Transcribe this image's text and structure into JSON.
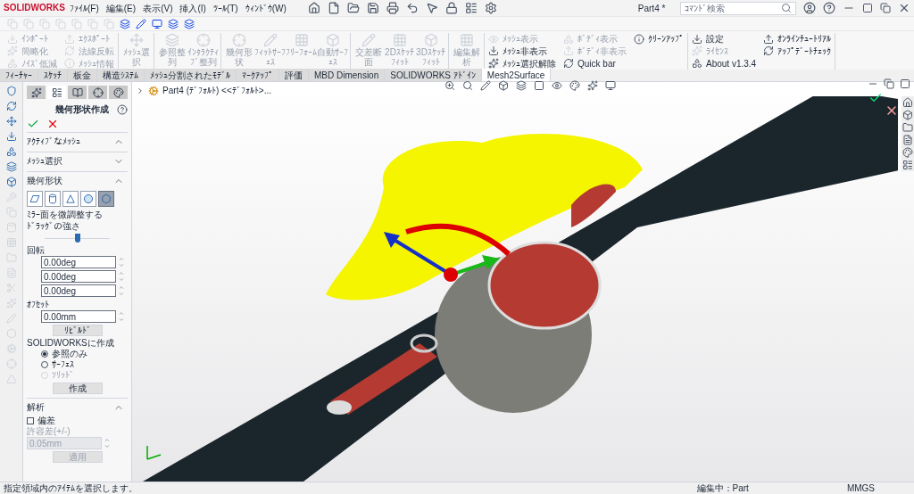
{
  "app": {
    "logo": "SOLIDWORKS",
    "menu": [
      "ﾌｧｲﾙ(F)",
      "編集(E)",
      "表示(V)",
      "挿入(I)",
      "ﾂｰﾙ(T)",
      "ｳｨﾝﾄﾞｳ(W)"
    ],
    "title": "Part4 *",
    "search": {
      "placeholder": "ｺﾏﾝﾄﾞ検索"
    }
  },
  "ribbon": {
    "groups": [
      {
        "kind": "small",
        "items": [
          {
            "label": "ｲﾝﾎﾟｰﾄ",
            "disabled": true
          },
          {
            "label": "簡略化",
            "disabled": true
          },
          {
            "label": "ﾉｲｽﾞ低減",
            "disabled": true
          },
          {
            "label": "ｴｸｽﾎﾟｰﾄ",
            "disabled": true
          },
          {
            "label": "法線反転",
            "disabled": true
          },
          {
            "label": "ﾒｯｼｭ情報",
            "disabled": true
          }
        ]
      },
      {
        "kind": "large",
        "items": [
          {
            "label": "ﾒｯｼｭ選択",
            "disabled": true
          }
        ]
      },
      {
        "kind": "large",
        "items": [
          {
            "label": "参照整列",
            "disabled": true
          },
          {
            "label": "ｲﾝﾀﾗｸﾃｨﾌﾞ整列",
            "disabled": true
          }
        ]
      },
      {
        "kind": "large",
        "items": [
          {
            "label": "幾何形状",
            "disabled": true
          },
          {
            "label": "ﾌｨｯﾄｻｰﾌｪｽ",
            "disabled": true
          },
          {
            "label": "ﾌﾘｰﾌｫｰﾑ",
            "disabled": true
          },
          {
            "label": "自動ｻｰﾌｪｽ",
            "disabled": true
          }
        ]
      },
      {
        "kind": "large",
        "items": [
          {
            "label": "交差断面",
            "disabled": true
          },
          {
            "label": "2Dｽｹｯﾁﾌｨｯﾄ",
            "disabled": true
          },
          {
            "label": "3Dｽｹｯﾁﾌｨｯﾄ",
            "disabled": true
          }
        ]
      },
      {
        "kind": "large",
        "items": [
          {
            "label": "編集解析",
            "disabled": true
          }
        ]
      },
      {
        "kind": "small",
        "items": [
          {
            "label": "ﾒｯｼｭ表示",
            "disabled": true
          },
          {
            "label": "ﾒｯｼｭ非表示",
            "disabled": false
          },
          {
            "label": "ﾒｯｼｭ選択解除",
            "disabled": false
          },
          {
            "label": "ﾎﾞﾃﾞｨ表示",
            "disabled": true
          },
          {
            "label": "ﾎﾞﾃﾞｨ非表示",
            "disabled": true
          },
          {
            "label": "Quick bar",
            "disabled": false
          },
          {
            "label": "ｸﾘｰﾝｱｯﾌﾟ",
            "disabled": false
          }
        ]
      },
      {
        "kind": "small",
        "items": [
          {
            "label": "設定",
            "disabled": false
          },
          {
            "label": "ﾗｲｾﾝｽ",
            "disabled": true
          },
          {
            "label": "About v1.3.4",
            "disabled": false
          },
          {
            "label": "ｵﾝﾗｲﾝﾁｭｰﾄﾘｱﾙ",
            "disabled": false
          },
          {
            "label": "ｱｯﾌﾟﾃﾞｰﾄﾁｪｯｸ",
            "disabled": false
          }
        ]
      }
    ]
  },
  "tabs": [
    {
      "label": "ﾌｨｰﾁｬｰ",
      "selected": false
    },
    {
      "label": "ｽｹｯﾁ",
      "selected": false
    },
    {
      "label": "板金",
      "selected": false
    },
    {
      "label": "構造ｼｽﾃﾑ",
      "selected": false
    },
    {
      "label": "ﾒｯｼｭ分割されたﾓﾃﾞﾙ",
      "selected": false
    },
    {
      "label": "ﾏｰｸｱｯﾌﾟ",
      "selected": false
    },
    {
      "label": "評価",
      "selected": false
    },
    {
      "label": "MBD Dimension",
      "selected": false
    },
    {
      "label": "SOLIDWORKS ｱﾄﾞｲﾝ",
      "selected": false
    },
    {
      "label": "Mesh2Surface",
      "selected": true
    }
  ],
  "panel": {
    "tabs": [
      {
        "selected": false
      },
      {
        "selected": true
      },
      {
        "selected": false
      },
      {
        "selected": false
      },
      {
        "selected": false
      }
    ],
    "title": "幾何形状作成",
    "sections": [
      {
        "title": "ｱｸﾃｨﾌﾞなﾒｯｼｭ",
        "expanded": true
      },
      {
        "title": "ﾒｯｼｭ選択",
        "expanded": false
      },
      {
        "title": "幾何形状",
        "expanded": true
      }
    ],
    "shapes": [
      {
        "kind": "plane",
        "selected": false
      },
      {
        "kind": "cylinder",
        "selected": false
      },
      {
        "kind": "cone",
        "selected": false
      },
      {
        "kind": "sphere",
        "selected": false
      },
      {
        "kind": "hexagon",
        "selected": true
      }
    ],
    "fine_tune": "ﾐﾗｰ面を微調整する",
    "drag_label": "ﾄﾞﾗｯｸﾞの強さ",
    "drag": {
      "level": 0.5
    },
    "rotation_label": "回転",
    "rotation": [
      "0.00deg",
      "0.00deg",
      "0.00deg"
    ],
    "offset_label": "ｵﾌｾｯﾄ",
    "offset": "0.00mm",
    "rebuild": "ﾘﾋﾞﾙﾄﾞ",
    "create_label": "SOLIDWORKSに作成",
    "create_options": [
      {
        "label": "参照のみ",
        "selected": true,
        "disabled": false
      },
      {
        "label": "ｻｰﾌｪｽ",
        "selected": false,
        "disabled": false
      },
      {
        "label": "ｿﾘｯﾄﾞ",
        "selected": false,
        "disabled": true
      }
    ],
    "create": "作成",
    "analysis": {
      "title": "解析",
      "expanded": true,
      "deviation": {
        "label": "偏差",
        "checked": false
      },
      "tolerance_label": "許容差(+/-)",
      "tolerance": "0.05mm",
      "apply": "適用",
      "disabled": true
    }
  },
  "viewport": {
    "tree_item": "Part4 (ﾃﾞﾌｫﾙﾄ) <<ﾃﾞﾌｫﾙﾄ>..."
  },
  "status_bar": {
    "message": "指定領域内のｱｲﾃﾑを選択します。",
    "editing": "編集中：Part",
    "units": "MMGS"
  }
}
